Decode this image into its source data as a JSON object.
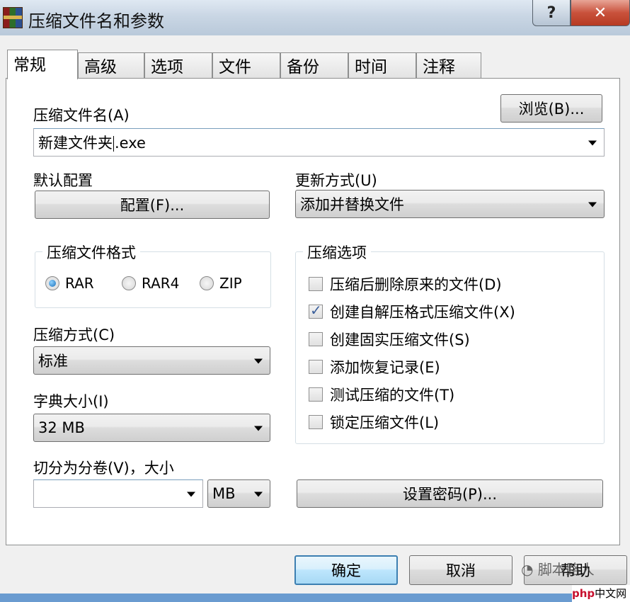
{
  "window": {
    "title": "压缩文件名和参数",
    "help_label": "?",
    "close_label": "✕"
  },
  "tabs": [
    {
      "label": "常规"
    },
    {
      "label": "高级"
    },
    {
      "label": "选项"
    },
    {
      "label": "文件"
    },
    {
      "label": "备份"
    },
    {
      "label": "时间"
    },
    {
      "label": "注释"
    }
  ],
  "general": {
    "archive_name_label": "压缩文件名(A)",
    "browse_button": "浏览(B)...",
    "archive_name_value": "新建文件夹",
    "archive_name_ext": ".exe",
    "default_profile_label": "默认配置",
    "profiles_button": "配置(F)...",
    "update_mode_label": "更新方式(U)",
    "update_mode_value": "添加并替换文件",
    "format_group_title": "压缩文件格式",
    "formats": [
      {
        "label": "RAR",
        "selected": true
      },
      {
        "label": "RAR4",
        "selected": false
      },
      {
        "label": "ZIP",
        "selected": false
      }
    ],
    "method_label": "压缩方式(C)",
    "method_value": "标准",
    "dict_label": "字典大小(I)",
    "dict_value": "32 MB",
    "split_label": "切分为分卷(V)，大小",
    "split_value": "",
    "split_unit": "MB",
    "options_group_title": "压缩选项",
    "options": [
      {
        "label": "压缩后删除原来的文件(D)",
        "checked": false
      },
      {
        "label": "创建自解压格式压缩文件(X)",
        "checked": true
      },
      {
        "label": "创建固实压缩文件(S)",
        "checked": false
      },
      {
        "label": "添加恢复记录(E)",
        "checked": false
      },
      {
        "label": "测试压缩的文件(T)",
        "checked": false
      },
      {
        "label": "锁定压缩文件(L)",
        "checked": false
      }
    ],
    "password_button": "设置密码(P)..."
  },
  "footer": {
    "ok": "确定",
    "cancel": "取消",
    "help": "帮助"
  },
  "watermarks": {
    "wechat": "脚本路人",
    "php_brand": "php",
    "php_site": "中文网"
  },
  "colors": {
    "accent_blue": "#3c7fb1",
    "close_red": "#c9523c",
    "check_blue": "#3b5f9b"
  }
}
